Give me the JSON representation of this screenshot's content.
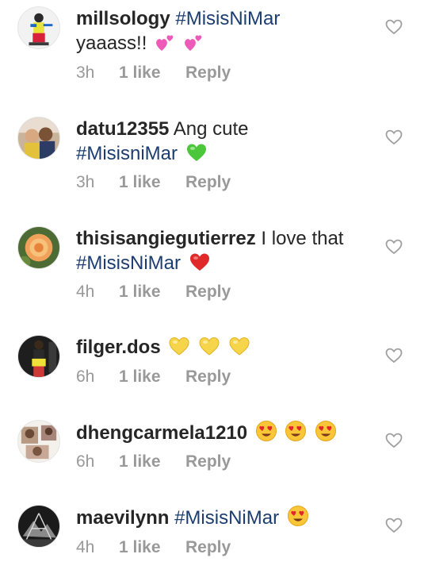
{
  "comments": [
    {
      "username": "millsology",
      "text_before": "",
      "hashtag": "#MisisNiMar",
      "text_after": "yaaass!!",
      "emojis": [
        "two-hearts-icon",
        "two-hearts-icon"
      ],
      "time": "3h",
      "likes": "1 like",
      "reply": "Reply"
    },
    {
      "username": "datu12355",
      "text_before": "Ang cute",
      "hashtag": "#MisisniMar",
      "text_after": "",
      "emojis": [
        "green-heart-icon"
      ],
      "time": "3h",
      "likes": "1 like",
      "reply": "Reply"
    },
    {
      "username": "thisisangiegutierrez",
      "text_before": "I love that",
      "hashtag": "#MisisNiMar",
      "text_after": "",
      "emojis": [
        "red-heart-icon"
      ],
      "time": "4h",
      "likes": "1 like",
      "reply": "Reply"
    },
    {
      "username": "filger.dos",
      "text_before": "",
      "hashtag": "",
      "text_after": "",
      "emojis": [
        "yellow-heart-icon",
        "yellow-heart-icon",
        "yellow-heart-icon"
      ],
      "time": "6h",
      "likes": "1 like",
      "reply": "Reply"
    },
    {
      "username": "dhengcarmela1210",
      "text_before": "",
      "hashtag": "",
      "text_after": "",
      "emojis": [
        "heart-eyes-icon",
        "heart-eyes-icon",
        "heart-eyes-icon"
      ],
      "time": "6h",
      "likes": "1 like",
      "reply": "Reply"
    },
    {
      "username": "maevilynn",
      "text_before": "",
      "hashtag": "#MisisNiMar",
      "text_after": "",
      "emojis": [
        "heart-eyes-icon"
      ],
      "time": "4h",
      "likes": "1 like",
      "reply": "Reply"
    }
  ],
  "colors": {
    "text": "#262626",
    "hashtag": "#1b3d6f",
    "meta": "#999999",
    "like_icon": "#a0a0a0"
  },
  "icons": {
    "like_button": "heart-outline-icon"
  }
}
